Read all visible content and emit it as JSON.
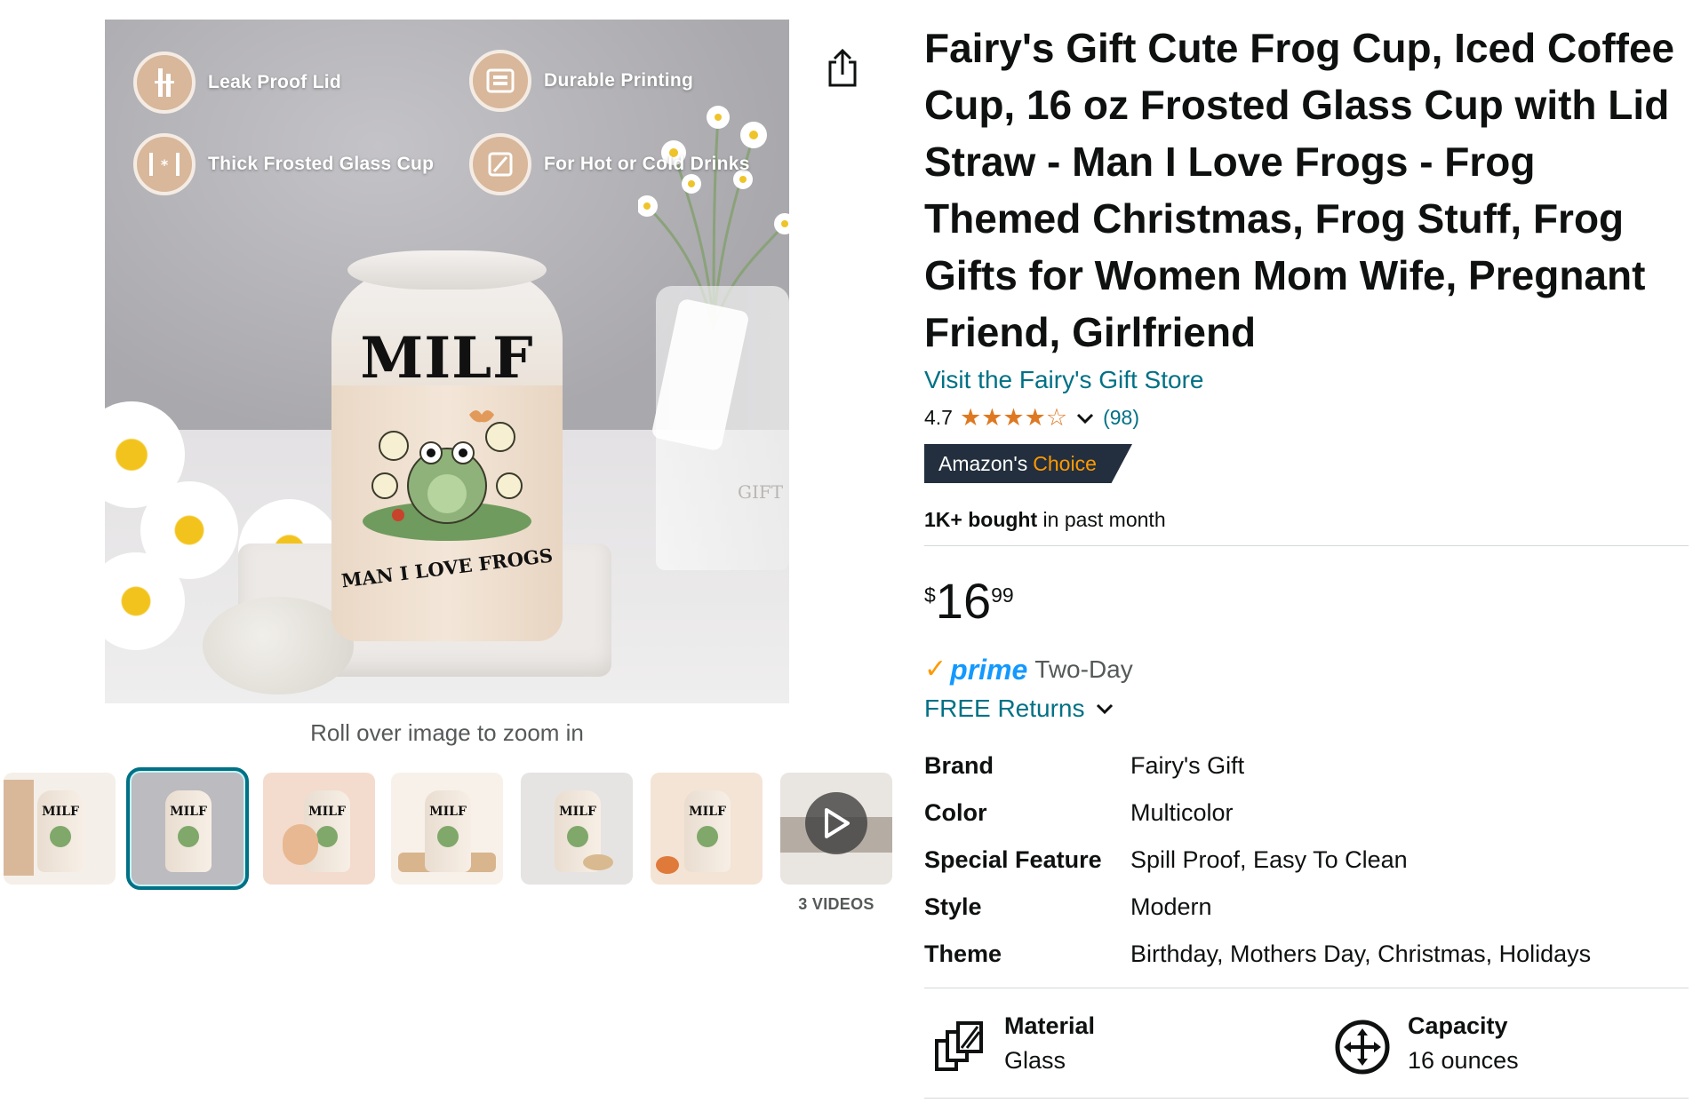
{
  "gallery": {
    "badges": [
      {
        "label": "Leak Proof Lid",
        "icon": "straw-icon"
      },
      {
        "label": "Durable Printing",
        "icon": "printer-icon"
      },
      {
        "label": "Thick Frosted Glass Cup",
        "icon": "thickness-icon"
      },
      {
        "label": "For Hot or Cold Drinks",
        "icon": "cup-icon"
      }
    ],
    "cup_text_top": "MILF",
    "cup_text_bottom": "MAN I LOVE FROGS",
    "vase_tag": "GIFT",
    "zoom_caption": "Roll over image to zoom in",
    "thumbnail_cup_text": "MILF",
    "videos_label": "3 VIDEOS"
  },
  "product": {
    "title": "Fairy's Gift Cute Frog Cup, Iced Coffee Cup, 16 oz Frosted Glass Cup with Lid Straw - Man I Love Frogs - Frog Themed Christmas, Frog Stuff, Frog Gifts for Women Mom Wife, Pregnant Friend, Girlfriend",
    "store_link": "Visit the Fairy's Gift Store",
    "rating": "4.7",
    "rating_stars": 4.7,
    "rating_count": "(98)",
    "choice_badge_a": "Amazon's",
    "choice_badge_b": "Choice",
    "bought_bold": "1K+ bought",
    "bought_rest": " in past month",
    "price_symbol": "$",
    "price_whole": "16",
    "price_fraction": "99",
    "prime_word": "prime",
    "prime_text": "Two-Day",
    "returns_link": "FREE Returns"
  },
  "specs": [
    {
      "key": "Brand",
      "value": "Fairy's Gift"
    },
    {
      "key": "Color",
      "value": "Multicolor"
    },
    {
      "key": "Special Feature",
      "value": "Spill Proof, Easy To Clean"
    },
    {
      "key": "Style",
      "value": "Modern"
    },
    {
      "key": "Theme",
      "value": "Birthday, Mothers Day, Christmas, Holidays"
    }
  ],
  "attributes": [
    {
      "label": "Material",
      "value": "Glass",
      "icon": "material-icon"
    },
    {
      "label": "Capacity",
      "value": "16 ounces",
      "icon": "capacity-icon"
    }
  ],
  "colors": {
    "link": "#007185",
    "star": "#de7921",
    "choice_bg": "#232f3e",
    "choice_accent": "#ff9900",
    "prime_blue": "#1399ff",
    "selected_thumb": "#007185"
  }
}
